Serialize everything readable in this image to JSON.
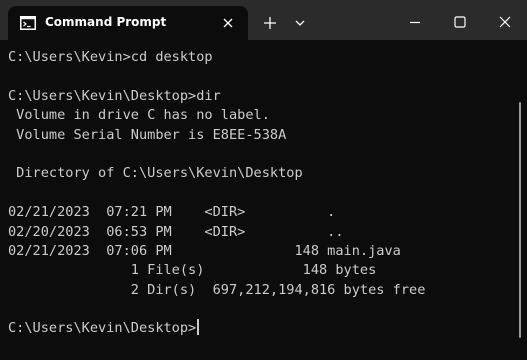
{
  "titlebar": {
    "tab_title": "Command Prompt"
  },
  "terminal": {
    "lines": [
      "C:\\Users\\Kevin>cd desktop",
      "",
      "C:\\Users\\Kevin\\Desktop>dir",
      " Volume in drive C has no label.",
      " Volume Serial Number is E8EE-538A",
      "",
      " Directory of C:\\Users\\Kevin\\Desktop",
      "",
      "02/21/2023  07:21 PM    <DIR>          .",
      "02/20/2023  06:53 PM    <DIR>          ..",
      "02/21/2023  07:06 PM               148 main.java",
      "               1 File(s)            148 bytes",
      "               2 Dir(s)  697,212,194,816 bytes free",
      "",
      "C:\\Users\\Kevin\\Desktop>"
    ]
  },
  "colors": {
    "titlebar_bg": "#2b2b2b",
    "terminal_bg": "#0c0c0c",
    "text": "#cccccc"
  },
  "icons": {
    "app": "terminal-icon",
    "tab_close": "close-icon",
    "new_tab": "plus-icon",
    "dropdown": "chevron-down-icon",
    "minimize": "minimize-icon",
    "maximize": "maximize-icon",
    "close": "close-icon"
  }
}
